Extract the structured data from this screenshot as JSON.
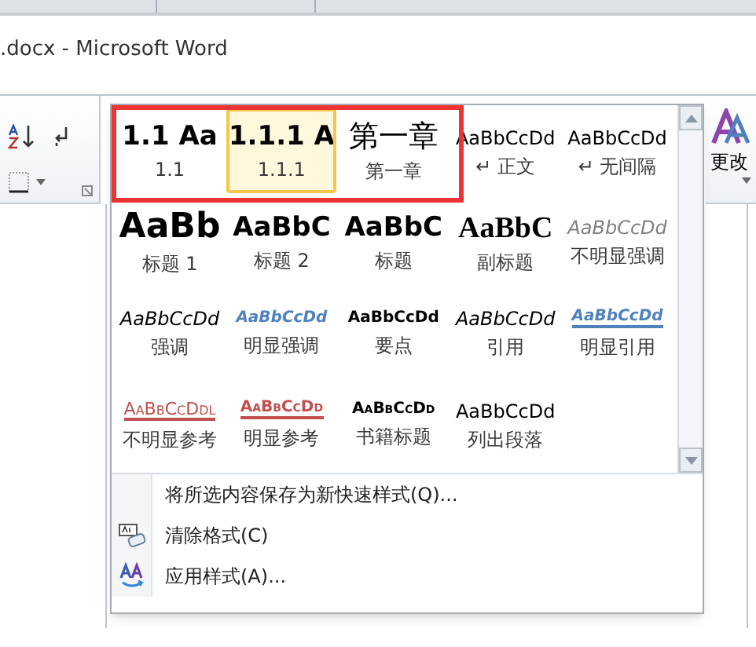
{
  "window": {
    "title": ".docx  -  Microsoft Word"
  },
  "ribbon": {
    "change_styles": "更改"
  },
  "styles_gallery": {
    "framed_items": [
      {
        "sample": "1.1  Aa",
        "label": "1.1",
        "kind": "heading-number",
        "selected": false
      },
      {
        "sample": "1.1.1  A",
        "label": "1.1.1",
        "kind": "heading-number",
        "selected": true
      },
      {
        "sample": "第一章",
        "label": "第一章",
        "kind": "chapter",
        "selected": false
      }
    ],
    "items": [
      {
        "sample": "AaBbCcDd",
        "label": "↵ 正文",
        "kind": "normal",
        "selected": false
      },
      {
        "sample": "AaBbCcDd",
        "label": "↵ 无间隔",
        "kind": "normal",
        "selected": false
      },
      {
        "sample": "AaBb",
        "label": "标题 1",
        "kind": "heading1",
        "selected": false
      },
      {
        "sample": "AaBbC",
        "label": "标题 2",
        "kind": "heading2",
        "selected": false
      },
      {
        "sample": "AaBbC",
        "label": "标题",
        "kind": "title",
        "selected": false
      },
      {
        "sample": "AaBbC",
        "label": "副标题",
        "kind": "subtitle",
        "selected": false
      },
      {
        "sample": "AaBbCcDd",
        "label": "不明显强调",
        "kind": "subtle",
        "selected": false
      },
      {
        "sample": "AaBbCcDd",
        "label": "强调",
        "kind": "emphasis",
        "selected": false
      },
      {
        "sample": "AaBbCcDd",
        "label": "明显强调",
        "kind": "intense",
        "selected": false
      },
      {
        "sample": "AaBbCcDd",
        "label": "要点",
        "kind": "strong",
        "selected": false
      },
      {
        "sample": "AaBbCcDd",
        "label": "引用",
        "kind": "quote",
        "selected": false
      },
      {
        "sample": "AaBbCcDd",
        "label": "明显引用",
        "kind": "underlined",
        "selected": false
      },
      {
        "sample": "AaBbCcDdl",
        "label": "不明显参考",
        "kind": "reference",
        "selected": false
      },
      {
        "sample": "AaBbCcDd",
        "label": "明显参考",
        "kind": "boldreference",
        "selected": false
      },
      {
        "sample": "AaBbCcDd",
        "label": "书籍标题",
        "kind": "book",
        "selected": false
      },
      {
        "sample": "AaBbCcDd",
        "label": "列出段落",
        "kind": "normal",
        "selected": false
      }
    ],
    "menu": [
      {
        "label": "将所选内容保存为新快速样式(Q)...",
        "kind": "none"
      },
      {
        "label": "清除格式(C)",
        "kind": "clear"
      },
      {
        "label": "应用样式(A)...",
        "kind": "apply"
      }
    ]
  }
}
